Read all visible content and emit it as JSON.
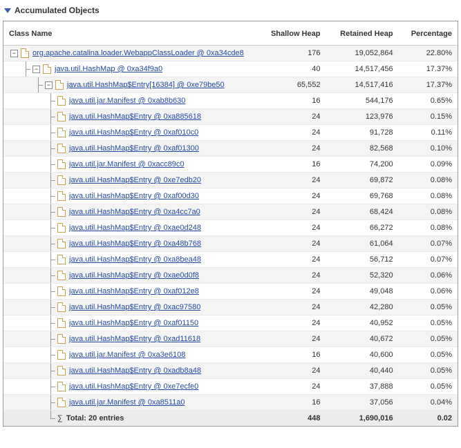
{
  "title": "Accumulated Objects",
  "columns": {
    "class_name": "Class Name",
    "shallow_heap": "Shallow Heap",
    "retained_heap": "Retained Heap",
    "percentage": "Percentage"
  },
  "rows": [
    {
      "level": 0,
      "expand": "-",
      "name": "org.apache.catalina.loader.WebappClassLoader @ 0xa34cde8",
      "shallow": "176",
      "retained": "19,052,864",
      "pct": "22.80%"
    },
    {
      "level": 1,
      "expand": "-",
      "name": "java.util.HashMap @ 0xa34f9a0",
      "shallow": "40",
      "retained": "14,517,456",
      "pct": "17.37%"
    },
    {
      "level": 2,
      "expand": "-",
      "name": "java.util.HashMap$Entry[16384] @ 0xe79be50",
      "shallow": "65,552",
      "retained": "14,517,416",
      "pct": "17.37%"
    },
    {
      "level": 3,
      "name": "java.util.jar.Manifest @ 0xab8b630",
      "shallow": "16",
      "retained": "544,176",
      "pct": "0.65%"
    },
    {
      "level": 3,
      "name": "java.util.HashMap$Entry @ 0xa885618",
      "shallow": "24",
      "retained": "123,976",
      "pct": "0.15%"
    },
    {
      "level": 3,
      "name": "java.util.HashMap$Entry @ 0xaf010c0",
      "shallow": "24",
      "retained": "91,728",
      "pct": "0.11%"
    },
    {
      "level": 3,
      "name": "java.util.HashMap$Entry @ 0xaf01300",
      "shallow": "24",
      "retained": "82,568",
      "pct": "0.10%"
    },
    {
      "level": 3,
      "name": "java.util.jar.Manifest @ 0xacc89c0",
      "shallow": "16",
      "retained": "74,200",
      "pct": "0.09%"
    },
    {
      "level": 3,
      "name": "java.util.HashMap$Entry @ 0xe7edb20",
      "shallow": "24",
      "retained": "69,872",
      "pct": "0.08%"
    },
    {
      "level": 3,
      "name": "java.util.HashMap$Entry @ 0xaf00d30",
      "shallow": "24",
      "retained": "69,768",
      "pct": "0.08%"
    },
    {
      "level": 3,
      "name": "java.util.HashMap$Entry @ 0xa4cc7a0",
      "shallow": "24",
      "retained": "68,424",
      "pct": "0.08%"
    },
    {
      "level": 3,
      "name": "java.util.HashMap$Entry @ 0xae0d248",
      "shallow": "24",
      "retained": "66,272",
      "pct": "0.08%"
    },
    {
      "level": 3,
      "name": "java.util.HashMap$Entry @ 0xa48b768",
      "shallow": "24",
      "retained": "61,064",
      "pct": "0.07%"
    },
    {
      "level": 3,
      "name": "java.util.HashMap$Entry @ 0xa8bea48",
      "shallow": "24",
      "retained": "56,712",
      "pct": "0.07%"
    },
    {
      "level": 3,
      "name": "java.util.HashMap$Entry @ 0xae0d0f8",
      "shallow": "24",
      "retained": "52,320",
      "pct": "0.06%"
    },
    {
      "level": 3,
      "name": "java.util.HashMap$Entry @ 0xaf012e8",
      "shallow": "24",
      "retained": "49,048",
      "pct": "0.06%"
    },
    {
      "level": 3,
      "name": "java.util.HashMap$Entry @ 0xac97580",
      "shallow": "24",
      "retained": "42,280",
      "pct": "0.05%"
    },
    {
      "level": 3,
      "name": "java.util.HashMap$Entry @ 0xaf01150",
      "shallow": "24",
      "retained": "40,952",
      "pct": "0.05%"
    },
    {
      "level": 3,
      "name": "java.util.HashMap$Entry @ 0xad11618",
      "shallow": "24",
      "retained": "40,672",
      "pct": "0.05%"
    },
    {
      "level": 3,
      "name": "java.util.jar.Manifest @ 0xa3e6108",
      "shallow": "16",
      "retained": "40,600",
      "pct": "0.05%"
    },
    {
      "level": 3,
      "name": "java.util.HashMap$Entry @ 0xadb8a48",
      "shallow": "24",
      "retained": "40,440",
      "pct": "0.05%"
    },
    {
      "level": 3,
      "name": "java.util.HashMap$Entry @ 0xe7ecfe0",
      "shallow": "24",
      "retained": "37,888",
      "pct": "0.05%"
    },
    {
      "level": 3,
      "name": "java.util.jar.Manifest @ 0xa8511a0",
      "shallow": "16",
      "retained": "37,056",
      "pct": "0.04%"
    }
  ],
  "total": {
    "level": 3,
    "label": "Total: 20 entries",
    "shallow": "448",
    "retained": "1,690,016",
    "pct": "0.02"
  }
}
